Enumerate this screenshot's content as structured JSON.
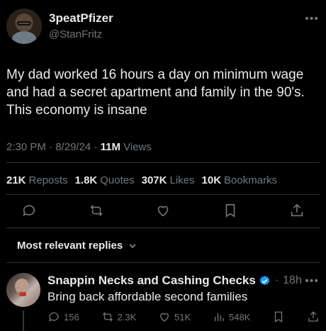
{
  "author": {
    "display_name": "3peatPfizer",
    "handle": "@StanFritz"
  },
  "tweet": {
    "text": "My dad worked 16 hours a day on minimum wage and had a secret apartment and family in the 90's. This economy is insane",
    "time": "2:30 PM",
    "date": "8/29/24",
    "views_count": "11M",
    "views_label": "Views"
  },
  "stats": {
    "reposts_count": "21K",
    "reposts_label": "Reposts",
    "quotes_count": "1.8K",
    "quotes_label": "Quotes",
    "likes_count": "307K",
    "likes_label": "Likes",
    "bookmarks_count": "10K",
    "bookmarks_label": "Bookmarks"
  },
  "sort": {
    "label": "Most relevant replies"
  },
  "reply": {
    "display_name": "Snappin Necks and Cashing Checks",
    "time": "18h",
    "text": "Bring back affordable second families",
    "replies": "156",
    "reposts": "2.3K",
    "likes": "51K",
    "views": "548K"
  },
  "colors": {
    "background": "#000000",
    "text": "#e7e9ea",
    "muted": "#71767b",
    "verified": "#1d9bf0"
  }
}
